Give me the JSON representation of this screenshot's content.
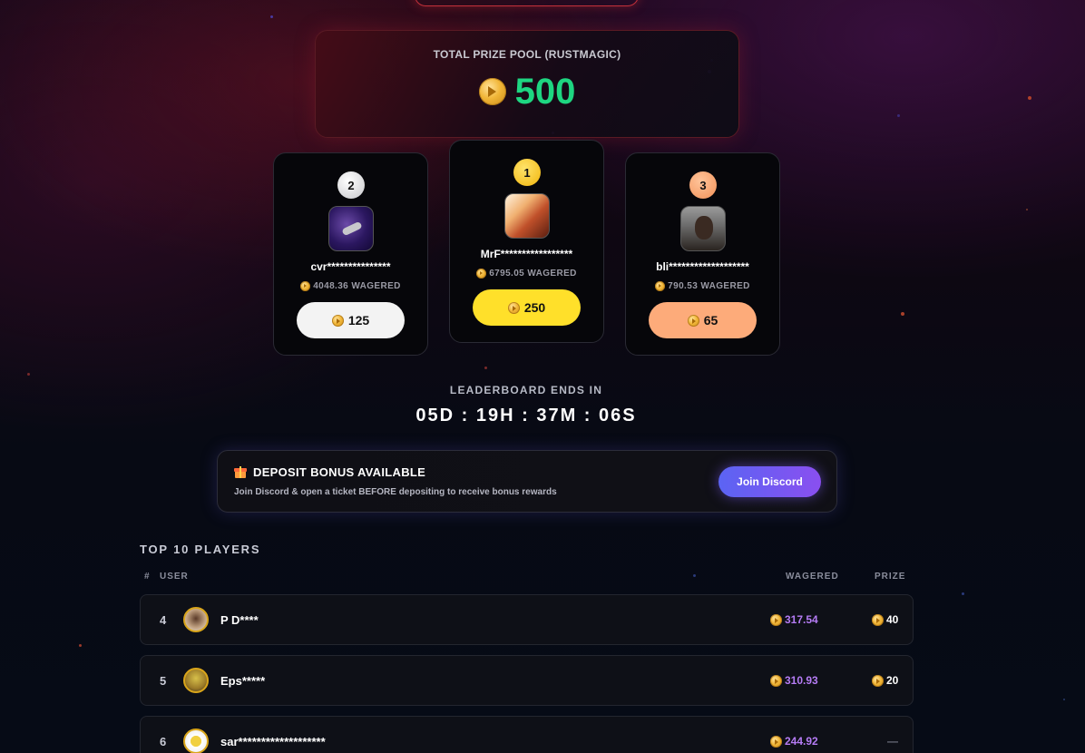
{
  "prize_pool": {
    "title": "TOTAL PRIZE POOL (RUSTMAGIC)",
    "amount": "500",
    "currency_icon": "coin-icon"
  },
  "podium": [
    {
      "rank": "2",
      "name": "cvr***************",
      "wagered": "4048.36 WAGERED",
      "prize": "125",
      "color": "#f3f3f3"
    },
    {
      "rank": "1",
      "name": "MrF*****************",
      "wagered": "6795.05 WAGERED",
      "prize": "250",
      "color": "#ffe02a"
    },
    {
      "rank": "3",
      "name": "bli*******************",
      "wagered": "790.53 WAGERED",
      "prize": "65",
      "color": "#fdab7a"
    }
  ],
  "countdown": {
    "label": "LEADERBOARD ENDS IN",
    "value": "05D : 19H : 37M : 06S"
  },
  "bonus": {
    "title": "DEPOSIT BONUS AVAILABLE",
    "subtitle": "Join Discord & open a ticket BEFORE depositing to receive bonus rewards",
    "button_label": "Join Discord",
    "icon": "gift-icon"
  },
  "leaderboard": {
    "title": "TOP 10 PLAYERS",
    "columns": {
      "num": "#",
      "user": "USER",
      "wagered": "WAGERED",
      "prize": "PRIZE"
    },
    "rows": [
      {
        "rank": "4",
        "name": "P D****",
        "wagered": "317.54",
        "prize": "40"
      },
      {
        "rank": "5",
        "name": "Eps*****",
        "wagered": "310.93",
        "prize": "20"
      },
      {
        "rank": "6",
        "name": "sar*******************",
        "wagered": "244.92",
        "prize": "—"
      }
    ]
  },
  "colors": {
    "accent_green": "#1ed681",
    "wager_purple": "#b57cf5",
    "gold": "#ffe02a",
    "silver": "#f3f3f3",
    "bronze": "#fdab7a",
    "discord_gradient": "#5b64f3"
  }
}
